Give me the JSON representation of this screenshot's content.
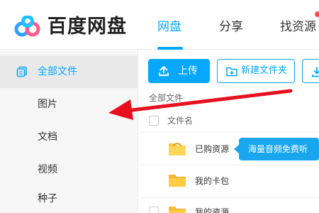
{
  "header": {
    "brand": "百度网盘",
    "tabs": [
      {
        "label": "网盘",
        "active": true
      },
      {
        "label": "分享",
        "active": false
      },
      {
        "label": "找资源",
        "active": false
      }
    ]
  },
  "sidebar": {
    "items": [
      {
        "label": "全部文件",
        "active": true,
        "icon": "files-icon"
      },
      {
        "label": "图片",
        "active": false
      },
      {
        "label": "文档",
        "active": false
      },
      {
        "label": "视频",
        "active": false
      },
      {
        "label": "种子",
        "active": false
      }
    ]
  },
  "toolbar": {
    "upload_label": "上传",
    "new_folder_label": "新建文件夹",
    "download_icon": "download-icon"
  },
  "main": {
    "breadcrumb": "全部文件",
    "column_header": "文件名",
    "files": [
      {
        "name": "已购资源",
        "icon": "purchased-folder-icon"
      },
      {
        "name": "我的卡包",
        "icon": "folder-icon"
      },
      {
        "name": "我的资源",
        "icon": "folder-icon"
      }
    ],
    "tooltip": "海量音频免费听"
  },
  "colors": {
    "accent": "#06a7ff",
    "annotation_arrow": "#e8101e",
    "tooltip_bg": "#1aa6ee"
  }
}
